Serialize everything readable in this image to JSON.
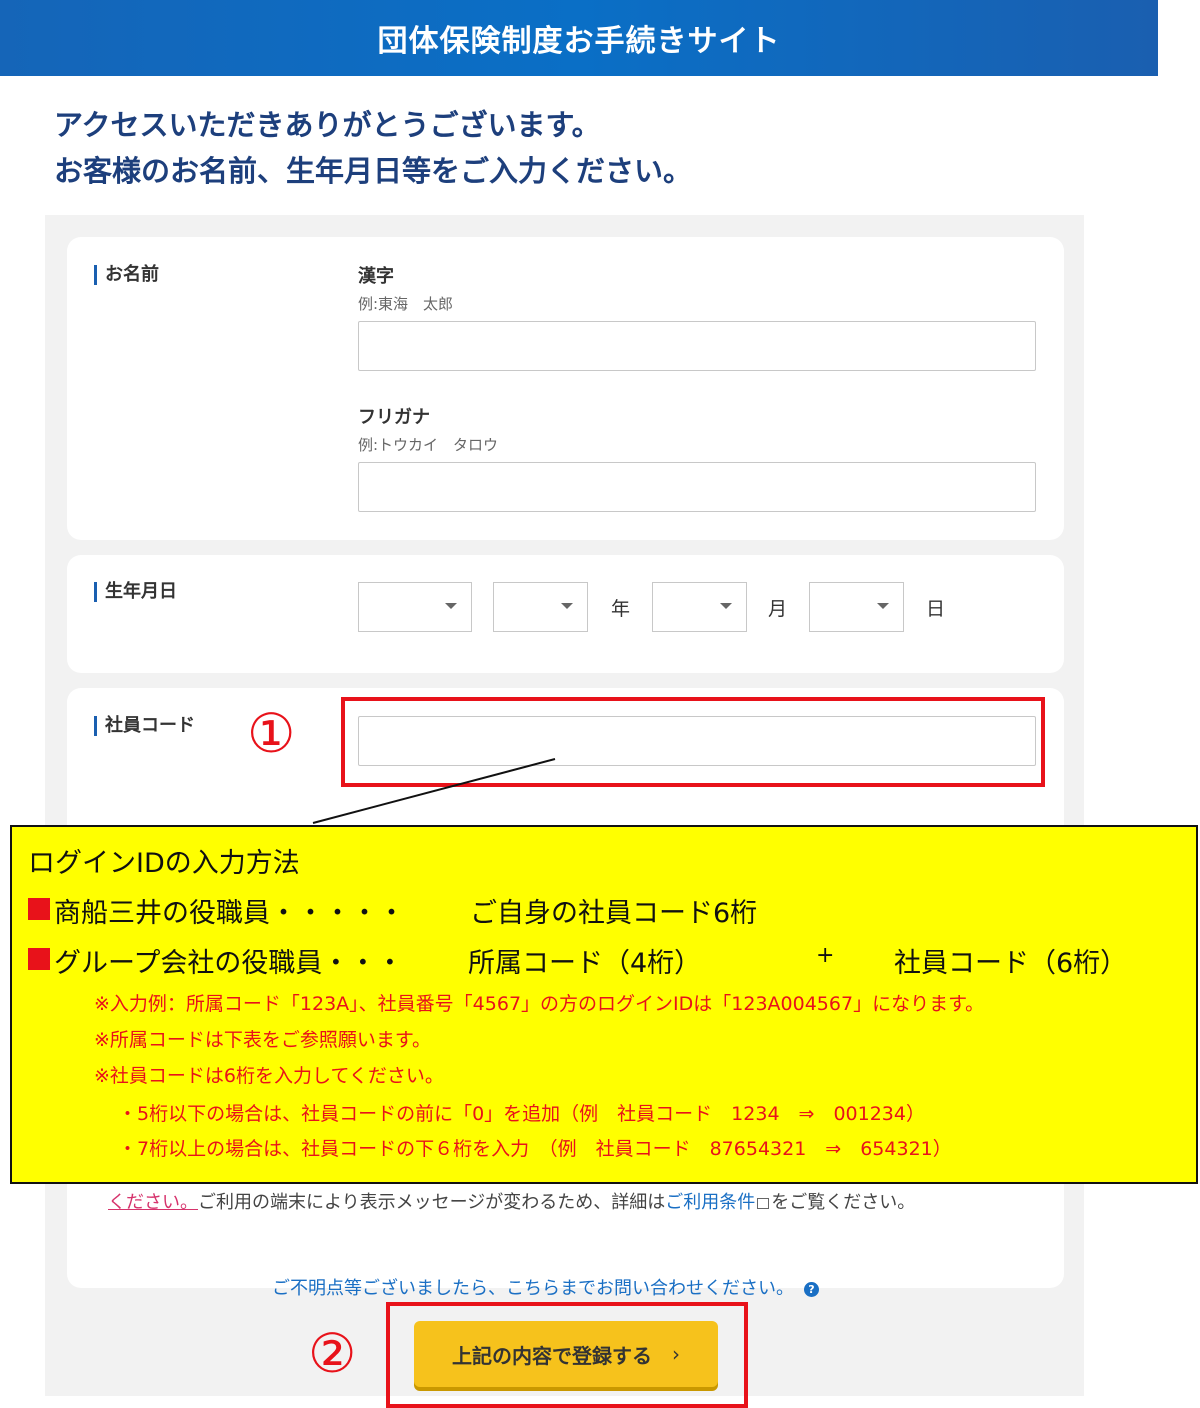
{
  "header": {
    "title": "団体保険制度お手続きサイト"
  },
  "intro": {
    "line1": "アクセスいただきありがとうございます。",
    "line2": "お客様のお名前、生年月日等をご入力ください。"
  },
  "form": {
    "name": {
      "label": "お名前",
      "kanji_label": "漢字",
      "kanji_example": "例:東海　太郎",
      "kanji_value": "",
      "kana_label": "フリガナ",
      "kana_example": "例:トウカイ　タロウ",
      "kana_value": ""
    },
    "birth": {
      "label": "生年月日",
      "era_value": "",
      "year_value": "",
      "year_unit": "年",
      "month_value": "",
      "month_unit": "月",
      "day_value": "",
      "day_unit": "日"
    },
    "employee_code": {
      "label": "社員コード",
      "value": ""
    }
  },
  "annotations": {
    "marker1": "①",
    "marker2": "②",
    "accent_color": "#e8121a",
    "callout_bg": "#ffff00"
  },
  "callout": {
    "title": "ログインIDの入力方法",
    "row1_label": "商船三井の役職員・・・・・",
    "row1_value": "ご自身の社員コード6桁",
    "row2_label": "グループ会社の役職員・・・",
    "row2_value1": "所属コード（4桁）",
    "row2_plus": "+",
    "row2_value2": "社員コード（6桁）",
    "notes": [
      "※入力例：所属コード「123A」、社員番号「4567」の方のログインIDは「123A004567」になります。",
      "※所属コードは下表をご参照願います。",
      "※社員コードは6桁を入力してください。",
      "・5桁以下の場合は、社員コードの前に「0」を追加（例　社員コード　1234　⇒　001234）",
      "・7桁以上の場合は、社員コードの下６桁を入力　（例　社員コード　87654321　⇒　654321）"
    ]
  },
  "footer_text": {
    "link_partial": "ください。",
    "text1": "ご利用の端末により表示メッセージが変わるため、詳細は",
    "terms_link": "ご利用条件",
    "text2": "をご覧ください。"
  },
  "inquiry": {
    "text": "ご不明点等ございましたら、こちらまでお問い合わせください。",
    "icon": "?"
  },
  "submit": {
    "label": "上記の内容で登録する",
    "chevron": "›"
  }
}
